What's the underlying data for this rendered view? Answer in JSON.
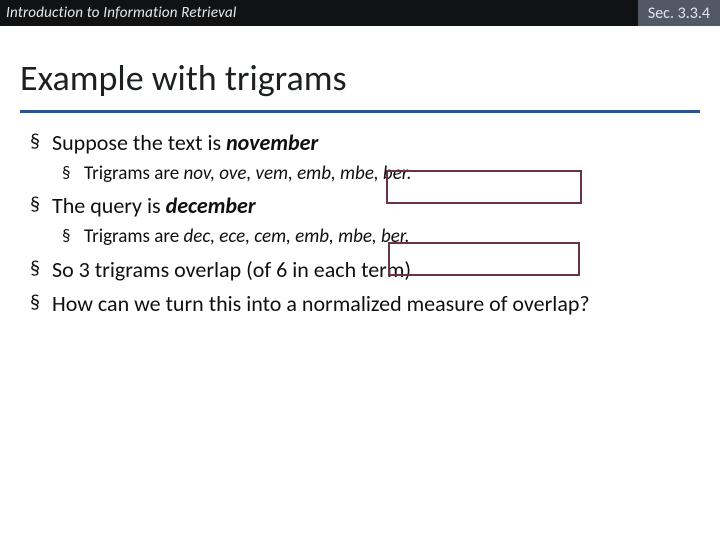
{
  "topbar": {
    "course": "Introduction to Information Retrieval",
    "section": "Sec. 3.3.4"
  },
  "title": "Example with trigrams",
  "bullets": {
    "b1_prefix": "Suppose the text is ",
    "b1_word": "november",
    "b1_sub_prefix": "Trigrams are ",
    "b1_sub_list": "nov, ove, vem, emb, mbe, ber.",
    "b2_prefix": "The query is ",
    "b2_word": "december",
    "b2_sub_prefix": "Trigrams are ",
    "b2_sub_list": "dec, ece, cem, emb, mbe, ber.",
    "b3": "So 3 trigrams overlap (of 6 in each term)",
    "b4": "How can we turn this into a normalized measure of overlap?"
  }
}
